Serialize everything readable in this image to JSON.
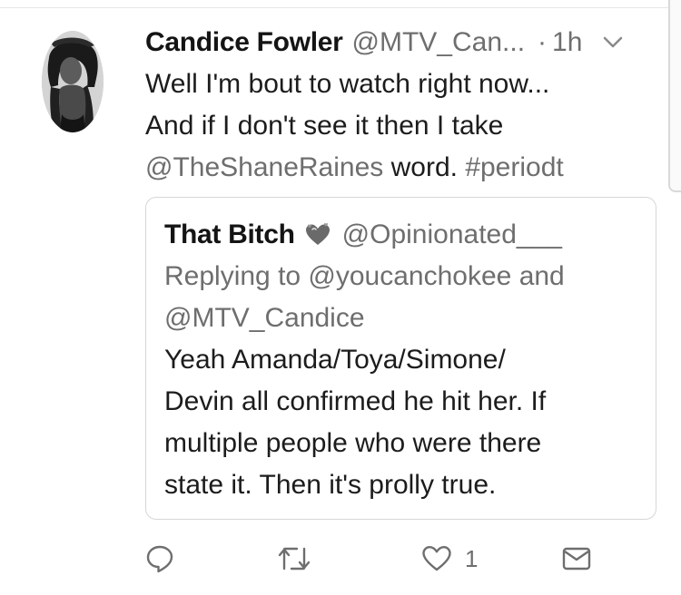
{
  "tweet": {
    "display_name": "Candice Fowler",
    "handle": "@MTV_Can...",
    "separator": "·",
    "time": "1h",
    "text_lines": [
      {
        "plain": "Well I'm bout to watch right now..."
      },
      {
        "plain": "And if I don't see it then I take"
      },
      {
        "mention": "@TheShaneRaines",
        "plain": " word. ",
        "hashtag": "#periodt"
      }
    ]
  },
  "quote": {
    "display_name": "That Bitch",
    "emoji": "heart-with-hearts-emoji",
    "handle": "@Opinionated___",
    "reply_lines": [
      "Replying to @youcanchokee and",
      "@MTV_Candice"
    ],
    "body_lines": [
      "Yeah Amanda/Toya/Simone/",
      "Devin all confirmed he hit her. If",
      "multiple people who were there",
      "state it. Then it's prolly true."
    ]
  },
  "actions": {
    "reply_icon": "reply-icon",
    "retweet_icon": "retweet-icon",
    "like_icon": "heart-icon",
    "like_count": "1",
    "dm_icon": "envelope-icon"
  },
  "colors": {
    "text": "#1c1c1c",
    "secondary": "#6e6e6e",
    "border": "#d6d6d6",
    "background": "#ffffff"
  }
}
